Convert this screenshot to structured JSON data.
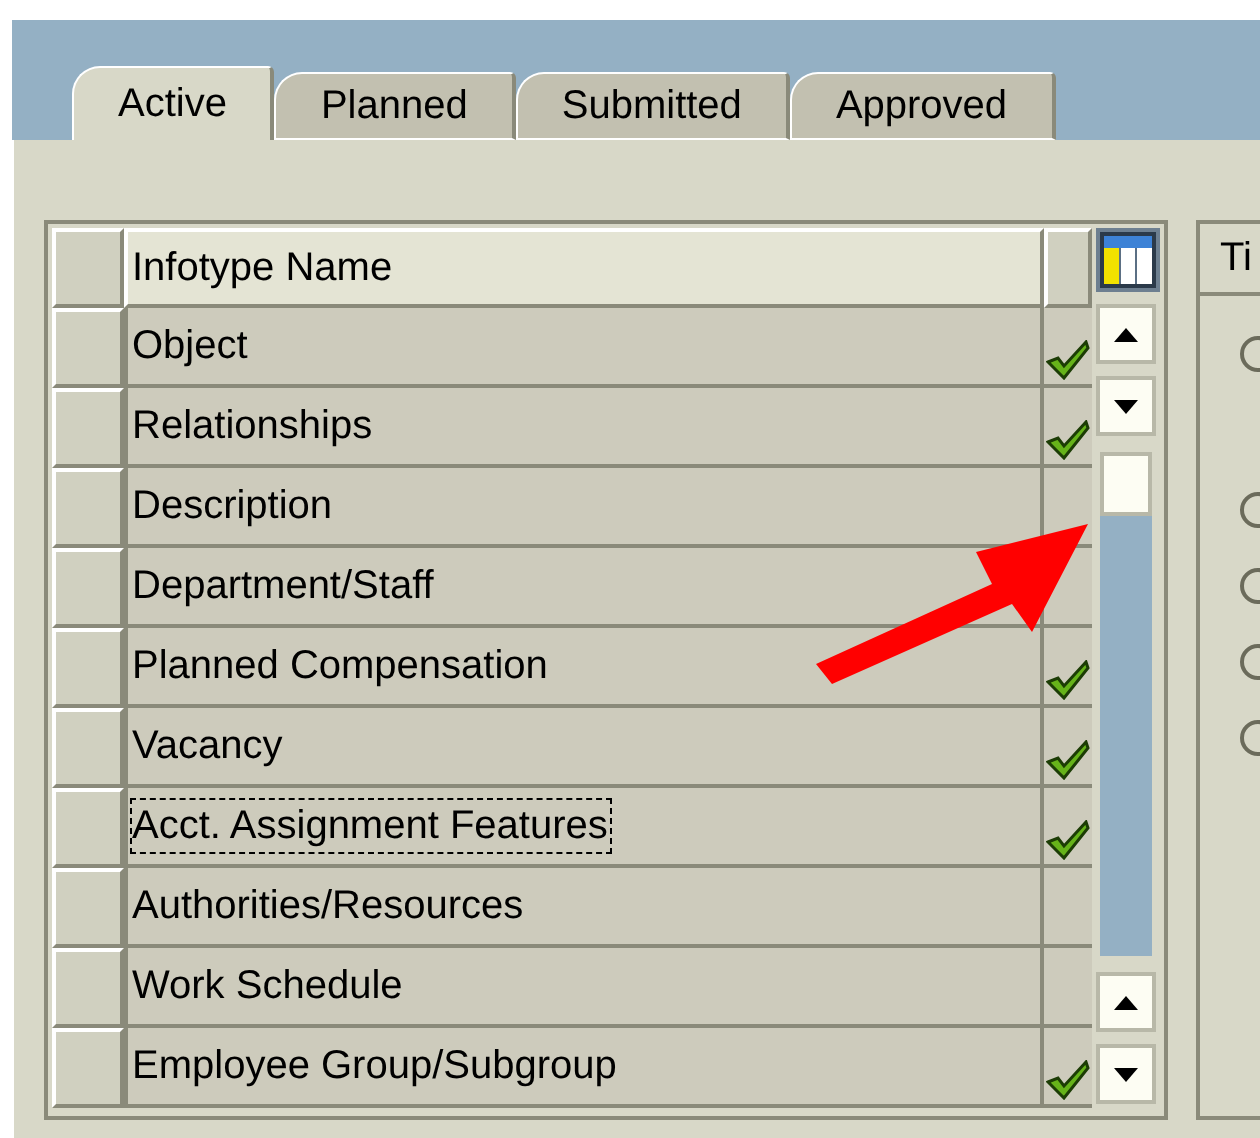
{
  "tabs": [
    {
      "label": "Active",
      "selected": true
    },
    {
      "label": "Planned",
      "selected": false
    },
    {
      "label": "Submitted",
      "selected": false
    },
    {
      "label": "Approved",
      "selected": false
    }
  ],
  "table": {
    "columns": [
      "Infotype Name"
    ],
    "rows": [
      {
        "name": "Object",
        "checked": true,
        "focused": false
      },
      {
        "name": "Relationships",
        "checked": true,
        "focused": false
      },
      {
        "name": "Description",
        "checked": false,
        "focused": false
      },
      {
        "name": "Department/Staff",
        "checked": false,
        "focused": false
      },
      {
        "name": "Planned Compensation",
        "checked": true,
        "focused": false
      },
      {
        "name": "Vacancy",
        "checked": true,
        "focused": false
      },
      {
        "name": "Acct. Assignment Features",
        "checked": true,
        "focused": true
      },
      {
        "name": "Authorities/Resources",
        "checked": false,
        "focused": false
      },
      {
        "name": "Work Schedule",
        "checked": false,
        "focused": false
      },
      {
        "name": "Employee Group/Subgroup",
        "checked": true,
        "focused": false
      }
    ]
  },
  "side_panel": {
    "header": "Ti"
  }
}
